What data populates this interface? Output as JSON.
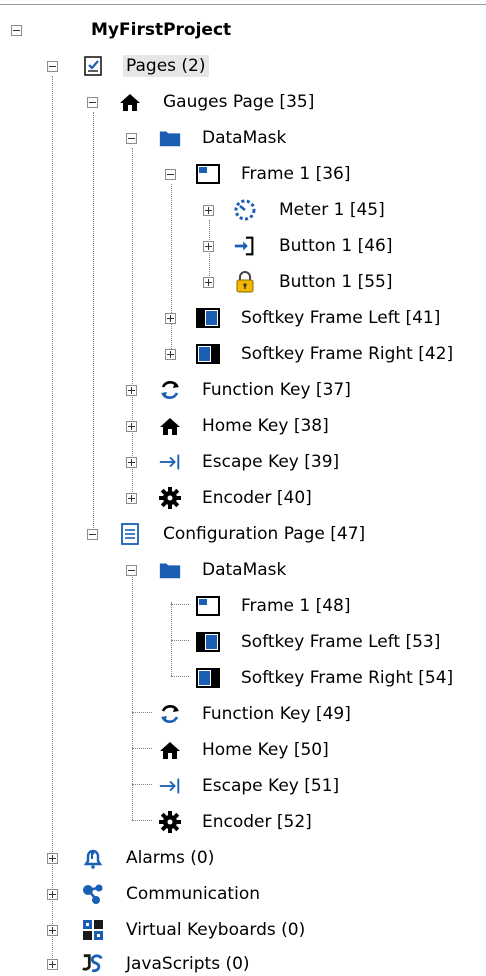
{
  "tree": {
    "project": "MyFirstProject",
    "pages": "Pages (2)",
    "gauges_page": "Gauges Page [35]",
    "gp_datamask": "DataMask",
    "gp_frame1": "Frame 1 [36]",
    "gp_meter1": "Meter 1 [45]",
    "gp_button46": "Button 1 [46]",
    "gp_button55": "Button 1 [55]",
    "gp_softkey_left": "Softkey Frame Left [41]",
    "gp_softkey_right": "Softkey Frame Right [42]",
    "gp_function_key": "Function Key [37]",
    "gp_home_key": "Home Key [38]",
    "gp_escape_key": "Escape Key [39]",
    "gp_encoder": "Encoder [40]",
    "config_page": "Configuration Page [47]",
    "cp_datamask": "DataMask",
    "cp_frame1": "Frame 1 [48]",
    "cp_softkey_left": "Softkey Frame Left [53]",
    "cp_softkey_right": "Softkey Frame Right [54]",
    "cp_function_key": "Function Key [49]",
    "cp_home_key": "Home Key [50]",
    "cp_escape_key": "Escape Key [51]",
    "cp_encoder": "Encoder [52]",
    "alarms": "Alarms (0)",
    "communication": "Communication",
    "virtual_keyboards": "Virtual Keyboards (0)",
    "javascripts": "JavaScripts (0)"
  },
  "colors": {
    "icon_blue": "#1a5fb4",
    "lock_yellow": "#f5b800",
    "selection_bg": "#e6e6e6"
  }
}
